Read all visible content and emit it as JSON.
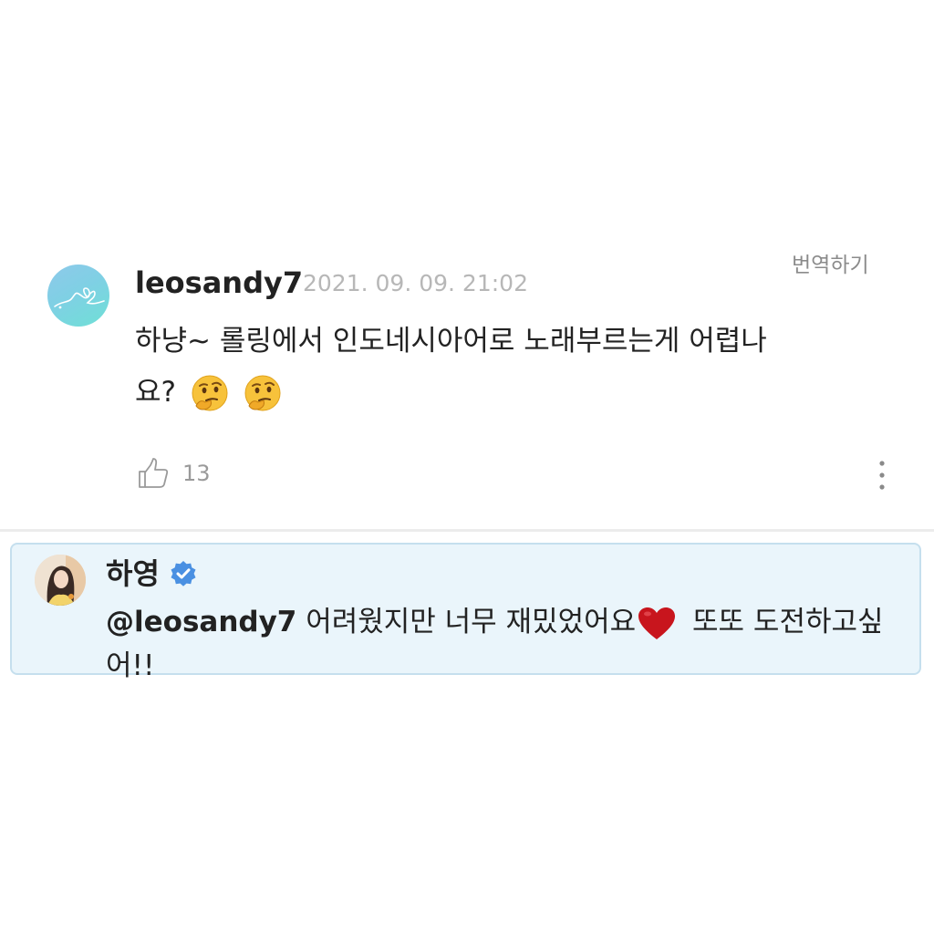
{
  "comment": {
    "username": "leosandy7",
    "timestamp": "2021. 09. 09. 21:02",
    "translate_label": "번역하기",
    "text": "하냥~ 롤링에서 인도네시아어로 노래부르는게 어렵나요?",
    "emoji": "thinking-face-emoji",
    "like_count": "13"
  },
  "reply": {
    "author": "하영",
    "verified": true,
    "mention": "@leosandy7",
    "text_before_emoji": " 어려웠지만 너무 재밌었어요",
    "emoji": "red-heart-emoji",
    "text_after_emoji": " 또또 도전하고싶어!!"
  },
  "colors": {
    "reply_background": "#eaf5fb",
    "reply_border": "#c5dfee",
    "verified_badge": "#4a90e2",
    "timestamp_gray": "#b7b7b7"
  }
}
